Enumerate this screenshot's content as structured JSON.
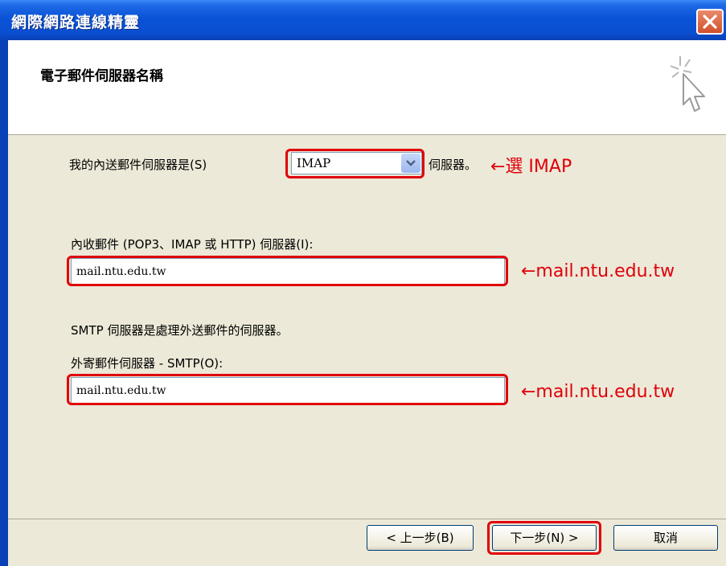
{
  "window": {
    "title": "網際網路連線精靈"
  },
  "header": {
    "title": "電子郵件伺服器名稱"
  },
  "incoming_type": {
    "label": "我的內送郵件伺服器是(S)",
    "value": "IMAP",
    "suffix": "伺服器。",
    "annotation": "←選 IMAP"
  },
  "incoming_server": {
    "label": "內收郵件 (POP3、IMAP 或 HTTP) 伺服器(I):",
    "value": "mail.ntu.edu.tw",
    "annotation": "←mail.ntu.edu.tw"
  },
  "smtp_note": "SMTP 伺服器是處理外送郵件的伺服器。",
  "outgoing_server": {
    "label": "外寄郵件伺服器 - SMTP(O):",
    "value": "mail.ntu.edu.tw",
    "annotation": "←mail.ntu.edu.tw"
  },
  "buttons": {
    "back": "< 上一步(B)",
    "next": "下一步(N) >",
    "cancel": "取消"
  },
  "colors": {
    "titlebar": "#0a53d6",
    "dialog_bg": "#ece9d8",
    "annotation_red": "#e0000a"
  },
  "icons": [
    "close-icon",
    "wizard-cursor-icon",
    "chevron-down-icon"
  ]
}
